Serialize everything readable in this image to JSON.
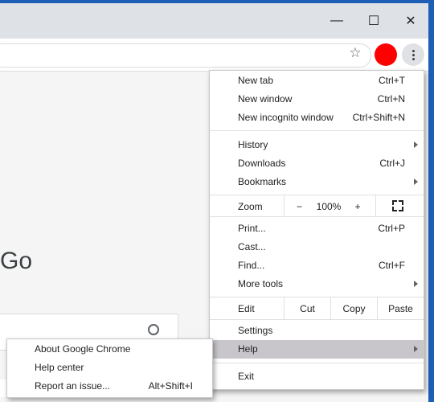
{
  "window": {
    "minimize_glyph": "—",
    "maximize_glyph": "☐",
    "close_glyph": "✕"
  },
  "toolbar": {
    "bookmark_glyph": "☆",
    "avatar_color": "#ff0000"
  },
  "page": {
    "logo_fragment": "Go"
  },
  "menu": {
    "new_tab": {
      "label": "New tab",
      "shortcut": "Ctrl+T"
    },
    "new_window": {
      "label": "New window",
      "shortcut": "Ctrl+N"
    },
    "new_incognito": {
      "label": "New incognito window",
      "shortcut": "Ctrl+Shift+N"
    },
    "history": {
      "label": "History"
    },
    "downloads": {
      "label": "Downloads",
      "shortcut": "Ctrl+J"
    },
    "bookmarks": {
      "label": "Bookmarks"
    },
    "zoom": {
      "label": "Zoom",
      "minus": "−",
      "level": "100%",
      "plus": "+"
    },
    "print": {
      "label": "Print...",
      "shortcut": "Ctrl+P"
    },
    "cast": {
      "label": "Cast..."
    },
    "find": {
      "label": "Find...",
      "shortcut": "Ctrl+F"
    },
    "more_tools": {
      "label": "More tools"
    },
    "edit": {
      "label": "Edit",
      "cut": "Cut",
      "copy": "Copy",
      "paste": "Paste"
    },
    "settings": {
      "label": "Settings"
    },
    "help": {
      "label": "Help"
    },
    "exit": {
      "label": "Exit"
    }
  },
  "help_submenu": {
    "about": {
      "label": "About Google Chrome"
    },
    "help_center": {
      "label": "Help center"
    },
    "report_issue": {
      "label": "Report an issue...",
      "shortcut": "Alt+Shift+I"
    }
  },
  "colors": {
    "menu_highlight": "#c8c6cb",
    "window_border": "#1c5fb5"
  }
}
